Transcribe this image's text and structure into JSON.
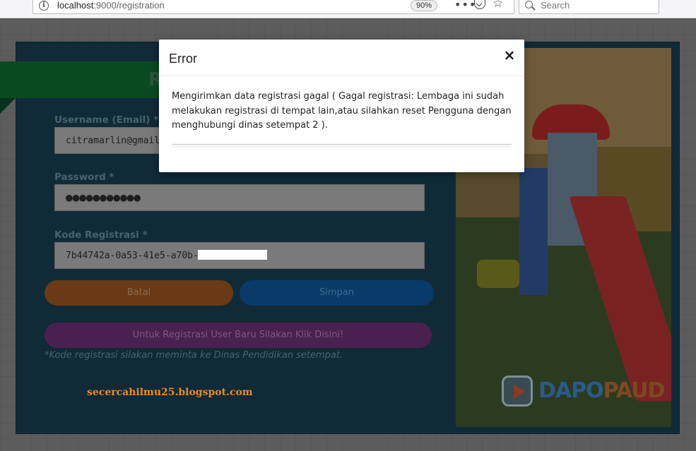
{
  "browser": {
    "url_host": "localhost",
    "url_rest": ":9000/registration",
    "zoom": "90%",
    "search_placeholder": "Search",
    "icons": [
      "info-icon",
      "more-icon",
      "pocket-icon",
      "bookmark-star-icon",
      "search-icon"
    ]
  },
  "form": {
    "heading_partial": "R",
    "username_label": "Username (Email) *",
    "username_value": "citramarlin@gmail.co",
    "password_label": "Password *",
    "password_value": "●●●●●●●●●●●",
    "regcode_label": "Kode Registrasi *",
    "regcode_value": "7b44742a-0a53-41e5-a70b-",
    "cancel_label": "Batal",
    "save_label": "Simpan",
    "new_user_label": "Untuk Registrasi User Baru Silakan Klik Disini!",
    "note": "*Kode registrasi silakan meminta ke Dinas Pendidikan setempat."
  },
  "watermark": "secercahilmu25.blogspot.com",
  "logo": {
    "part1": "DAPO",
    "part2": "PAUD"
  },
  "modal": {
    "title": "Error",
    "close": "×",
    "message": "Mengirimkan data registrasi gagal ( Gagal registrasi: Lembaga ini sudah melakukan registrasi di tempat lain,atau silahkan reset Pengguna dengan menghubungi dinas setempat 2 )."
  }
}
